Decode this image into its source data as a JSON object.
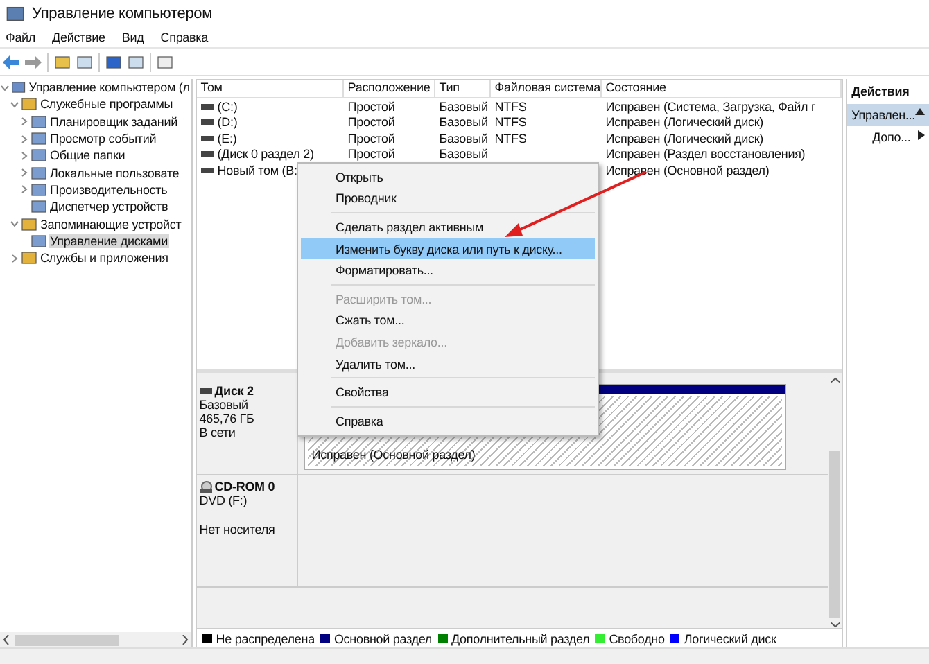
{
  "window": {
    "title": "Управление компьютером"
  },
  "menu_bar": [
    "Файл",
    "Действие",
    "Вид",
    "Справка"
  ],
  "tree": [
    {
      "label": "Управление компьютером (л",
      "expanded": true,
      "selected": false,
      "children": [
        {
          "label": "Служебные программы",
          "expanded": true,
          "selected": false,
          "children": [
            {
              "label": "Планировщик заданий",
              "expanded": false,
              "selected": false
            },
            {
              "label": "Просмотр событий",
              "expanded": false,
              "selected": false
            },
            {
              "label": "Общие папки",
              "expanded": false,
              "selected": false
            },
            {
              "label": "Локальные пользовате",
              "expanded": false,
              "selected": false
            },
            {
              "label": "Производительность",
              "expanded": false,
              "selected": false
            },
            {
              "label": "Диспетчер устройств",
              "selected": false
            }
          ]
        },
        {
          "label": "Запоминающие устройст",
          "expanded": true,
          "selected": false,
          "children": [
            {
              "label": "Управление дисками",
              "selected": true
            }
          ]
        },
        {
          "label": "Службы и приложения",
          "expanded": false,
          "selected": false
        }
      ]
    }
  ],
  "table": {
    "columns": [
      "Том",
      "Расположение",
      "Тип",
      "Файловая система",
      "Состояние"
    ],
    "rows": [
      {
        "volume": "(C:)",
        "location": "Простой",
        "type": "Базовый",
        "fs": "NTFS",
        "status": "Исправен (Система, Загрузка, Файл г"
      },
      {
        "volume": "(D:)",
        "location": "Простой",
        "type": "Базовый",
        "fs": "NTFS",
        "status": "Исправен (Логический диск)"
      },
      {
        "volume": "(E:)",
        "location": "Простой",
        "type": "Базовый",
        "fs": "NTFS",
        "status": "Исправен (Логический диск)"
      },
      {
        "volume": "(Диск 0 раздел 2)",
        "location": "Простой",
        "type": "Базовый",
        "status": "Исправен (Раздел восстановления)"
      },
      {
        "volume": "Новый том (B:",
        "status": "Исправен (Основной раздел)"
      }
    ]
  },
  "context_menu": [
    {
      "kind": "item",
      "label": "Открыть",
      "disabled": false,
      "selected": false
    },
    {
      "kind": "item",
      "label": "Проводник",
      "disabled": false,
      "selected": false
    },
    {
      "kind": "separator"
    },
    {
      "kind": "item",
      "label": "Сделать раздел активным",
      "disabled": false,
      "selected": false
    },
    {
      "kind": "item",
      "label": "Изменить букву диска или путь к диску...",
      "disabled": false,
      "selected": true
    },
    {
      "kind": "item",
      "label": "Форматировать...",
      "disabled": false,
      "selected": false
    },
    {
      "kind": "separator"
    },
    {
      "kind": "item",
      "label": "Расширить том...",
      "disabled": true,
      "selected": false
    },
    {
      "kind": "item",
      "label": "Сжать том...",
      "disabled": false,
      "selected": false
    },
    {
      "kind": "item",
      "label": "Добавить зеркало...",
      "disabled": true,
      "selected": false
    },
    {
      "kind": "item",
      "label": "Удалить том...",
      "disabled": false,
      "selected": false
    },
    {
      "kind": "separator"
    },
    {
      "kind": "item",
      "label": "Свойства",
      "disabled": false,
      "selected": false
    },
    {
      "kind": "separator"
    },
    {
      "kind": "item",
      "label": "Справка",
      "disabled": false,
      "selected": false
    }
  ],
  "disks": [
    {
      "kind": "disk",
      "name": "Диск 2",
      "lines": [
        "Базовый",
        "465,76 ГБ",
        "В сети"
      ],
      "partition": {
        "status": "Исправен (Основной раздел)",
        "color": "#000080"
      }
    },
    {
      "kind": "cdrom",
      "name": "CD-ROM 0",
      "lines": [
        "DVD (F:)",
        "Нет носителя"
      ]
    }
  ],
  "legend": [
    {
      "label": "Не распределена",
      "color": "#000000"
    },
    {
      "label": "Основной раздел",
      "color": "#000080"
    },
    {
      "label": "Дополнительный раздел",
      "color": "#008000"
    },
    {
      "label": "Свободно",
      "color": "#33ee33"
    },
    {
      "label": "Логический диск",
      "color": "#0000ff"
    }
  ],
  "actions": {
    "title": "Действия",
    "items": [
      {
        "label": "Управлен...",
        "kind": "group"
      },
      {
        "label": "Допо...",
        "kind": "submenu"
      }
    ]
  }
}
